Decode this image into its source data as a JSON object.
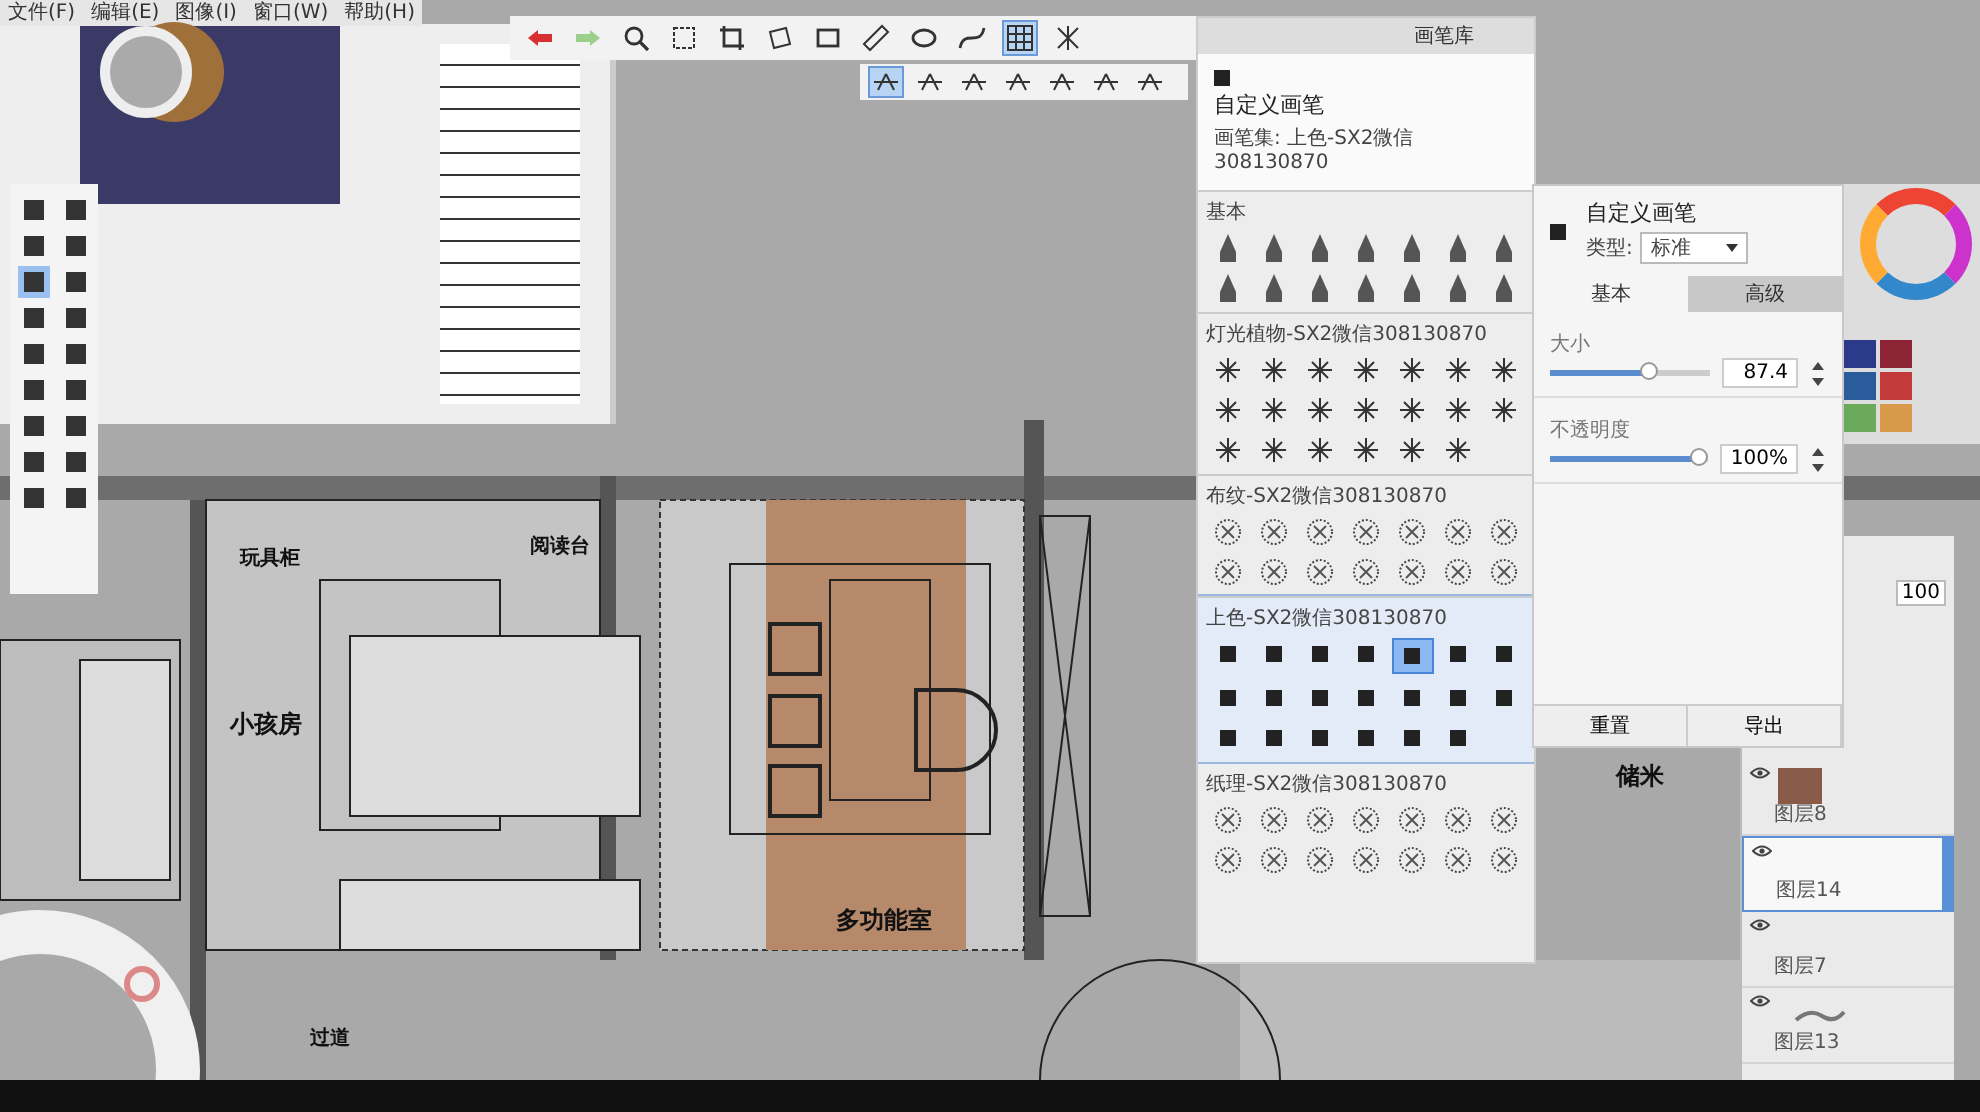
{
  "menu": [
    "文件(F)",
    "编辑(E)",
    "图像(I)",
    "窗口(W)",
    "帮助(H)"
  ],
  "toolbar": {
    "tools": [
      {
        "kind": "undo",
        "selected": false
      },
      {
        "kind": "redo",
        "selected": false
      },
      {
        "kind": "search",
        "selected": false
      },
      {
        "kind": "select",
        "selected": false
      },
      {
        "kind": "crop",
        "selected": false
      },
      {
        "kind": "transform",
        "selected": false
      },
      {
        "kind": "shape",
        "selected": false
      },
      {
        "kind": "ruler",
        "selected": false
      },
      {
        "kind": "ellipse",
        "selected": false
      },
      {
        "kind": "curve",
        "selected": false
      },
      {
        "kind": "grid",
        "selected": true
      },
      {
        "kind": "symmetry",
        "selected": false
      }
    ],
    "subtools": [
      {
        "selected": true
      },
      {
        "selected": false
      },
      {
        "selected": false
      },
      {
        "selected": false
      },
      {
        "selected": false
      },
      {
        "selected": false
      },
      {
        "selected": false
      }
    ]
  },
  "plan": {
    "labels": [
      {
        "text": "玩具柜",
        "kind": "small"
      },
      {
        "text": "阅读台",
        "kind": "small"
      },
      {
        "text": "小孩房",
        "kind": "room"
      },
      {
        "text": "多功能室",
        "kind": "room"
      },
      {
        "text": "过道",
        "kind": "small"
      },
      {
        "text": "储米",
        "kind": "room"
      }
    ]
  },
  "brush_library": {
    "title": "画笔库",
    "brush_name": "自定义画笔",
    "brush_set": "画笔集: 上色-SX2微信308130870",
    "sets": [
      {
        "name": "基本",
        "kind": "pens",
        "selected": false
      },
      {
        "name": "灯光植物-SX2微信308130870",
        "kind": "sprays",
        "selected": false
      },
      {
        "name": "布纹-SX2微信308130870",
        "kind": "textures",
        "selected": false
      },
      {
        "name": "上色-SX2微信308130870",
        "kind": "blocks",
        "selected": true
      },
      {
        "name": "纸理-SX2微信308130870",
        "kind": "textures",
        "selected": false
      }
    ],
    "color_brushes": [
      {
        "selected": false
      },
      {
        "selected": false
      },
      {
        "selected": false
      },
      {
        "selected": false
      },
      {
        "selected": true
      },
      {
        "selected": false
      },
      {
        "selected": false
      },
      {
        "selected": false
      },
      {
        "selected": false
      },
      {
        "selected": false
      },
      {
        "selected": false
      },
      {
        "selected": false
      },
      {
        "selected": false
      },
      {
        "selected": false
      },
      {
        "selected": false
      },
      {
        "selected": false
      },
      {
        "selected": false
      },
      {
        "selected": false
      },
      {
        "selected": false
      },
      {
        "selected": false
      }
    ]
  },
  "brush_editor": {
    "name": "自定义画笔",
    "type_label": "类型:",
    "type_value": "标准",
    "tabs": [
      {
        "label": "基本",
        "selected": true
      },
      {
        "label": "高级",
        "selected": false
      }
    ],
    "sliders": [
      {
        "label": "大小",
        "level": 0.62,
        "reading": "87.4"
      },
      {
        "label": "不透明度",
        "level": 0.94,
        "reading": "100%"
      }
    ],
    "buttons": [
      "重置",
      "导出"
    ]
  },
  "swatches": [
    {
      "color": "#2c3a8c"
    },
    {
      "color": "#8c2436"
    },
    {
      "color": "#2a5c9c"
    },
    {
      "color": "#c23a3a"
    },
    {
      "color": "#6aaa5a"
    },
    {
      "color": "#d89a4a"
    }
  ],
  "layers": {
    "opacity": "100",
    "items": [
      {
        "name": "图层8",
        "visible": true,
        "selected": false,
        "kind": "swatch"
      },
      {
        "name": "图层14",
        "visible": true,
        "selected": true,
        "kind": "empty"
      },
      {
        "name": "图层7",
        "visible": true,
        "selected": false,
        "kind": "empty"
      },
      {
        "name": "图层13",
        "visible": true,
        "selected": false,
        "kind": "stroke"
      }
    ]
  }
}
